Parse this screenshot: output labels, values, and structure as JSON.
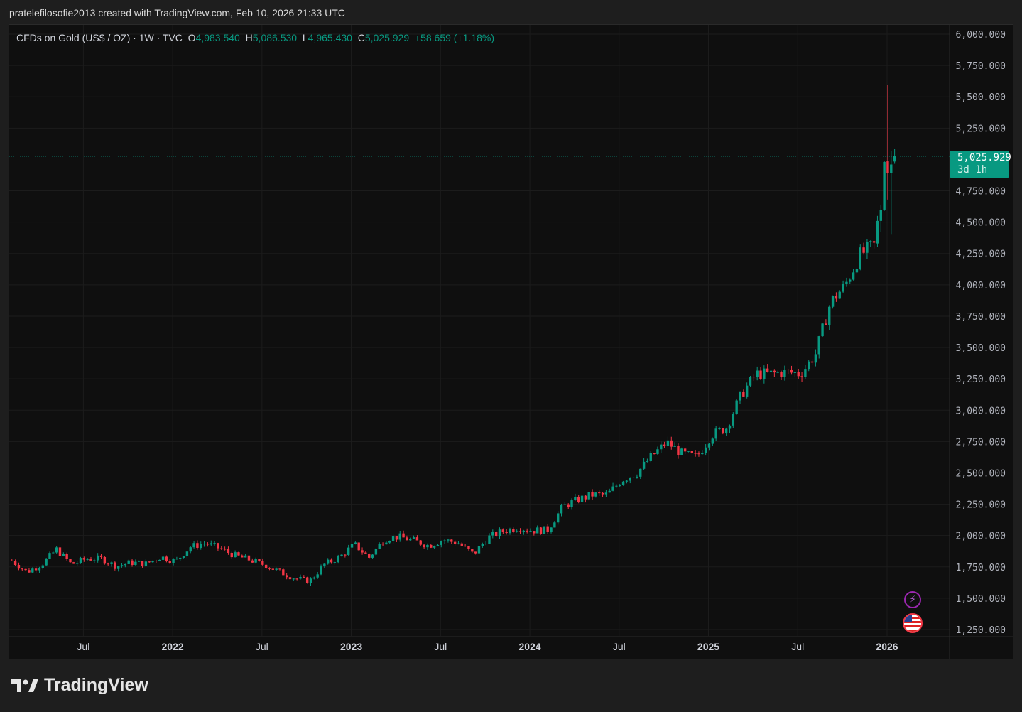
{
  "caption": "pratelefilosofie2013 created with TradingView.com, Feb 10, 2026 21:33 UTC",
  "legend": {
    "title": "CFDs on Gold (US$ / OZ) · 1W · TVC",
    "o_label": "O",
    "o": "4,983.540",
    "h_label": "H",
    "h": "5,086.530",
    "l_label": "L",
    "l": "4,965.430",
    "c_label": "C",
    "c": "5,025.929",
    "change": "+58.659 (+1.18%)"
  },
  "price_tag": {
    "price": "5,025.929",
    "countdown": "3d 1h"
  },
  "logo": "TradingView",
  "colors": {
    "up": "#089981",
    "down": "#f23645",
    "background": "#0f0f0f"
  },
  "icons": [
    "lightning-icon",
    "us-flag-icon"
  ],
  "chart_data": {
    "type": "candlestick",
    "title": "CFDs on Gold (US$ / OZ) · 1W · TVC",
    "ylim": [
      1250,
      6000
    ],
    "y_ticks": [
      "6,000.000",
      "5,750.000",
      "5,500.000",
      "5,250.000",
      "4,750.000",
      "4,500.000",
      "4,250.000",
      "4,000.000",
      "3,750.000",
      "3,500.000",
      "3,250.000",
      "3,000.000",
      "2,750.000",
      "2,500.000",
      "2,250.000",
      "2,000.000",
      "1,750.000",
      "1,500.000",
      "1,250.000"
    ],
    "x_ticks": [
      {
        "label": "Jul",
        "t": 2021.5
      },
      {
        "label": "2022",
        "t": 2022.0
      },
      {
        "label": "Jul",
        "t": 2022.5
      },
      {
        "label": "2023",
        "t": 2023.0
      },
      {
        "label": "Jul",
        "t": 2023.5
      },
      {
        "label": "2024",
        "t": 2024.0
      },
      {
        "label": "Jul",
        "t": 2024.5
      },
      {
        "label": "2025",
        "t": 2025.0
      },
      {
        "label": "Jul",
        "t": 2025.5
      },
      {
        "label": "2026",
        "t": 2026.0
      }
    ],
    "xlim": [
      2021.085,
      2026.35
    ],
    "monthly_closes_start": 2021.1,
    "monthly_closes": [
      1800,
      1710,
      1770,
      1890,
      1770,
      1815,
      1815,
      1755,
      1785,
      1775,
      1830,
      1795,
      1910,
      1940,
      1895,
      1840,
      1805,
      1765,
      1710,
      1660,
      1635,
      1770,
      1825,
      1930,
      1825,
      1970,
      1990,
      1960,
      1920,
      1965,
      1940,
      1850,
      1985,
      2035,
      2063,
      2040,
      2045,
      2230,
      2285,
      2325,
      2325,
      2445,
      2500,
      2635,
      2745,
      2655,
      2625,
      2800,
      2860,
      3125,
      3290,
      3290,
      3305,
      3290,
      3450,
      3860,
      4000,
      4240,
      4320
    ],
    "recent_weekly": [
      {
        "o": 4330,
        "h": 4550,
        "l": 4300,
        "c": 4510
      },
      {
        "o": 4510,
        "h": 4640,
        "l": 4420,
        "c": 4600
      },
      {
        "o": 4600,
        "h": 4990,
        "l": 4590,
        "c": 4980
      },
      {
        "o": 4985,
        "h": 5595,
        "l": 4680,
        "c": 4890
      },
      {
        "o": 4890,
        "h": 5070,
        "l": 4400,
        "c": 4960
      },
      {
        "o": 4983.54,
        "h": 5086.53,
        "l": 4965.43,
        "c": 5025.929
      }
    ],
    "last_price": 5025.929
  }
}
